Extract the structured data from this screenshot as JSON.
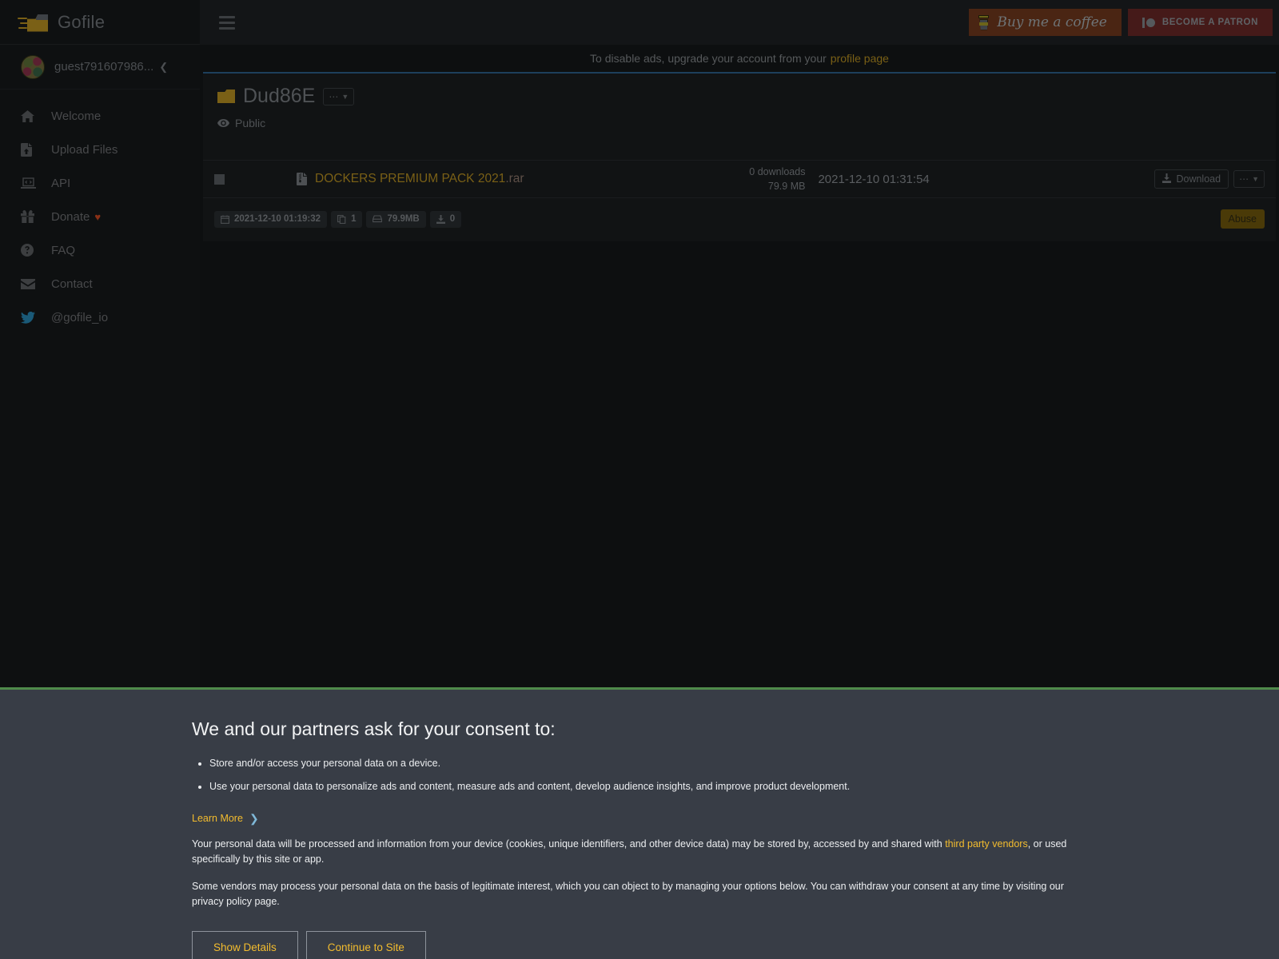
{
  "brand": {
    "name": "Gofile",
    "logo_icon": "gofile-logo-icon"
  },
  "user": {
    "name": "guest791607986...",
    "collapse_icon": "chevron-left-icon"
  },
  "sidebar": {
    "items": [
      {
        "label": "Welcome",
        "icon": "home-icon"
      },
      {
        "label": "Upload Files",
        "icon": "file-upload-icon"
      },
      {
        "label": "API",
        "icon": "laptop-code-icon"
      },
      {
        "label": "Donate",
        "icon": "gift-icon",
        "suffix": "♥"
      },
      {
        "label": "FAQ",
        "icon": "question-circle-icon"
      },
      {
        "label": "Contact",
        "icon": "envelope-icon"
      },
      {
        "label": "@gofile_io",
        "icon": "twitter-icon"
      }
    ]
  },
  "topbar": {
    "menu_icon": "hamburger-icon",
    "coffee_label": "Buy me a coffee",
    "coffee_icon": "coffee-cup-icon",
    "patron_label": "BECOME A PATRON",
    "patron_icon": "patreon-icon"
  },
  "ad_notice": {
    "text": "To disable ads, upgrade your account from your",
    "link": "profile page"
  },
  "folder": {
    "name": "Dud86E",
    "folder_icon": "folder-icon",
    "options_icon": "ellipsis-icon",
    "visibility": "Public",
    "visibility_icon": "eye-icon"
  },
  "file_table": {
    "rows": [
      {
        "name": "DOCKERS PREMIUM PACK 2021",
        "ext": ".rar",
        "type_icon": "archive-file-icon",
        "downloads": "0 downloads",
        "size": "79.9 MB",
        "date": "2021-12-10 01:31:54",
        "download_label": "Download",
        "download_icon": "download-icon",
        "options_icon": "ellipsis-icon"
      }
    ]
  },
  "stats": {
    "badges": [
      {
        "icon": "calendar-icon",
        "value": "2021-12-10 01:19:32"
      },
      {
        "icon": "copy-icon",
        "value": "1"
      },
      {
        "icon": "hdd-icon",
        "value": "79.9MB"
      },
      {
        "icon": "download-icon",
        "value": "0"
      }
    ],
    "abuse_label": "Abuse"
  },
  "consent": {
    "title": "We and our partners ask for your consent to:",
    "bullets": [
      "Store and/or access your personal data on a device.",
      "Use your personal data to personalize ads and content, measure ads and content, develop audience insights, and improve product development."
    ],
    "learn_more": "Learn More",
    "learn_more_icon": "chevron-right-icon",
    "para1_before": "Your personal data will be processed and information from your device (cookies, unique identifiers, and other device data) may be stored by, accessed by and shared with ",
    "para1_link": "third party vendors",
    "para1_after": ", or used specifically by this site or app.",
    "para2": "Some vendors may process your personal data on the basis of legitimate interest, which you can object to by managing your options below. You can withdraw your consent at any time by visiting our privacy policy page.",
    "show_details_label": "Show Details",
    "continue_label": "Continue to Site"
  },
  "colors": {
    "accent_gold": "#7a6016",
    "consent_accent": "#f3bc2e",
    "consent_bg": "#383d46",
    "consent_border": "#4f8a4b",
    "panel_border": "#1d3f5c",
    "coffee_bg": "#4a2513",
    "patron_bg": "#451a19",
    "abuse_bg": "#4a3a08"
  }
}
